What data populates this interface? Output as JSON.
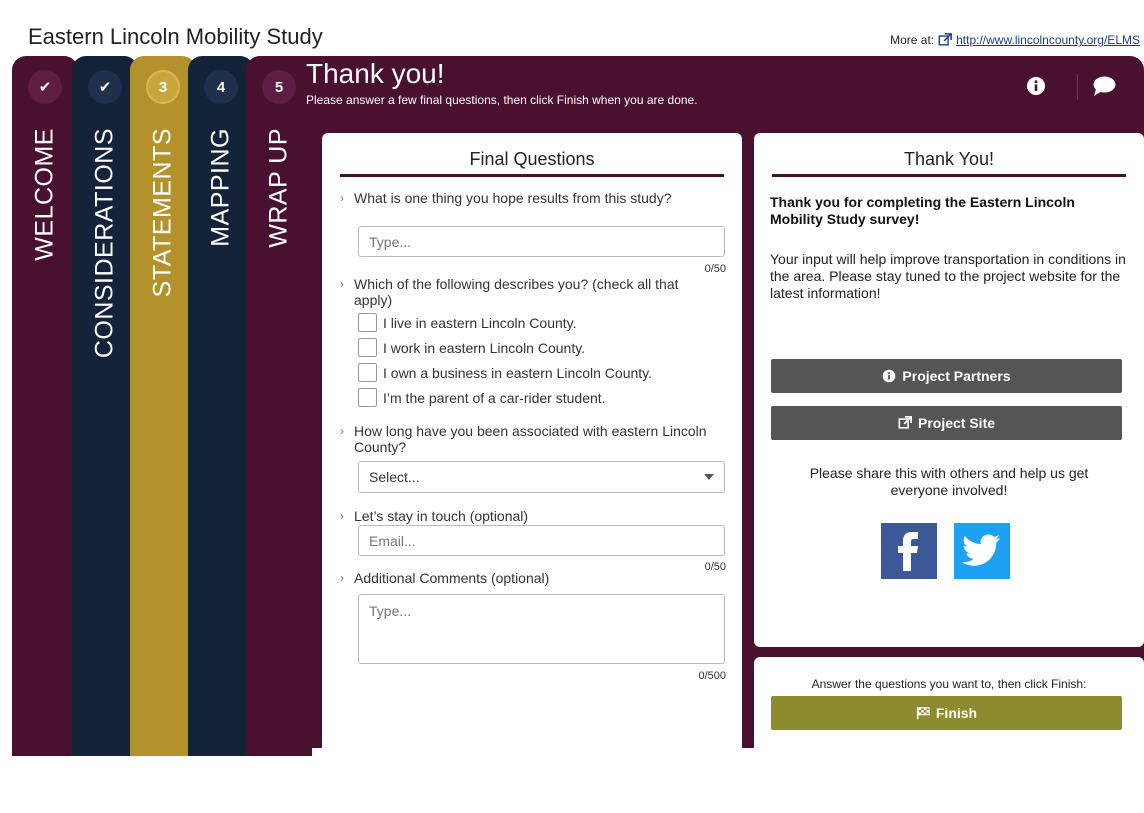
{
  "app": {
    "title": "Eastern Lincoln Mobility Study",
    "more_at_label": "More at:",
    "more_at_link": "http://www.lincolncounty.org/ELMS"
  },
  "steps": [
    {
      "badge": "✔",
      "label": "WELCOME",
      "state": "complete"
    },
    {
      "badge": "✔",
      "label": "CONSIDERATIONS",
      "state": "complete"
    },
    {
      "badge": "3",
      "label": "STATEMENTS",
      "state": "active"
    },
    {
      "badge": "4",
      "label": "MAPPING",
      "state": "pending"
    },
    {
      "badge": "5",
      "label": "WRAP UP",
      "state": "pending"
    }
  ],
  "header": {
    "title": "Thank you!",
    "subtitle": "Please answer a few final questions, then click Finish when you are done."
  },
  "questions": {
    "heading": "Final Questions",
    "q1": {
      "label": "What is one thing you hope results from this study?",
      "placeholder": "Type...",
      "counter": "0/50"
    },
    "q2": {
      "label": "Which of the following describes you? (check all that apply)",
      "options": [
        "I live in eastern Lincoln County.",
        "I work in eastern Lincoln County.",
        "I own a business in eastern Lincoln County.",
        "I’m the parent of a car-rider student."
      ]
    },
    "q3": {
      "label": "How long have you been associated with eastern Lincoln County?",
      "selected": "Select..."
    },
    "q4": {
      "label": "Let’s stay in touch (optional)",
      "placeholder": "Email...",
      "counter": "0/50"
    },
    "q5": {
      "label": "Additional Comments (optional)",
      "placeholder": "Type...",
      "counter": "0/500"
    }
  },
  "thanks": {
    "heading": "Thank You!",
    "bold_text": "Thank you for completing the Eastern Lincoln Mobility Study survey!",
    "body_text": "Your input will help improve transportation in conditions in the area. Please stay tuned to the project website for the latest information!",
    "partners_label": "Project Partners",
    "site_label": "Project Site",
    "share_text": "Please share this with others and help us get everyone involved!"
  },
  "finish": {
    "note": "Answer the questions you want to, then click Finish:",
    "button_label": "Finish"
  },
  "colors": {
    "maroon": "#4a1030",
    "navy": "#14223a",
    "gold": "#b3922c",
    "olive": "#8c8c2f",
    "facebook": "#3b5998",
    "twitter": "#1da1f2"
  }
}
